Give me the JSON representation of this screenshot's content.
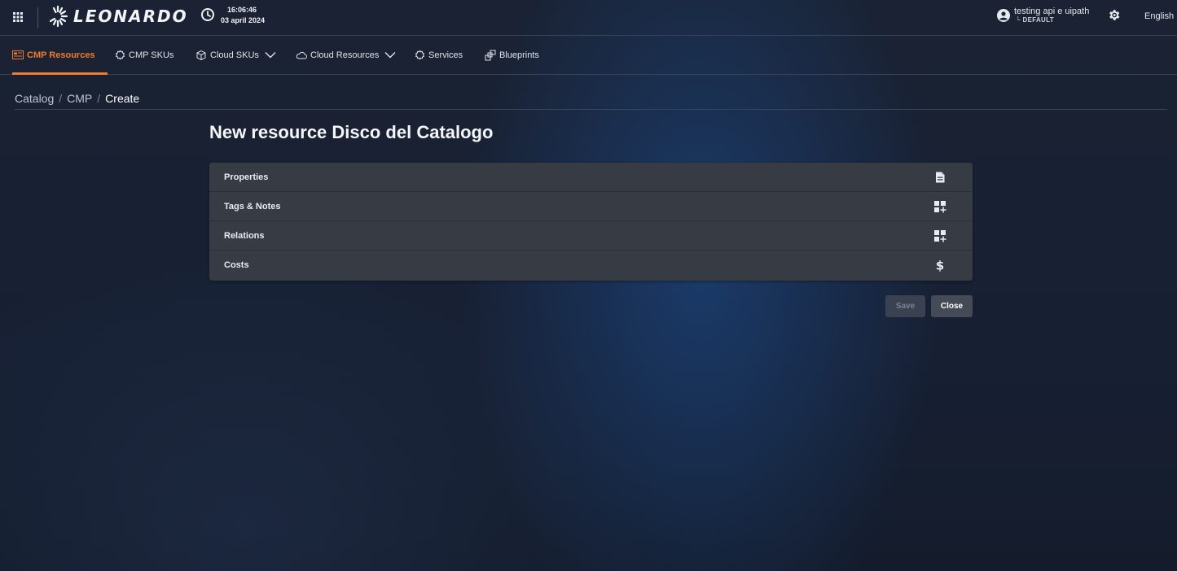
{
  "header": {
    "logo_text": "LEONARDO",
    "clock_time": "16:06:46",
    "clock_date": "03 april 2024",
    "user_name": "testing api e uipath",
    "user_tenant": "└ DEFAULT",
    "language": "English"
  },
  "nav": {
    "tabs": [
      {
        "label": "CMP Resources",
        "icon": "cmp-resources-icon",
        "active": true
      },
      {
        "label": "CMP SKUs",
        "icon": "gear-outline-icon"
      },
      {
        "label": "Cloud SKUs",
        "icon": "cloud-sku-icon",
        "dropdown": true
      },
      {
        "label": "Cloud Resources",
        "icon": "cloud-icon",
        "dropdown": true
      },
      {
        "label": "Services",
        "icon": "gear-outline-icon"
      },
      {
        "label": "Blueprints",
        "icon": "blueprint-icon"
      }
    ],
    "accent_color": "#f07b2e"
  },
  "breadcrumb": {
    "items": [
      "Catalog",
      "CMP",
      "Create"
    ]
  },
  "main": {
    "title": "New resource Disco del Catalogo",
    "sections": [
      {
        "label": "Properties",
        "icon": "document-icon"
      },
      {
        "label": "Tags & Notes",
        "icon": "add-widget-icon"
      },
      {
        "label": "Relations",
        "icon": "add-widget-icon"
      },
      {
        "label": "Costs",
        "icon": "dollar-icon"
      }
    ],
    "actions": {
      "save_label": "Save",
      "close_label": "Close"
    }
  }
}
